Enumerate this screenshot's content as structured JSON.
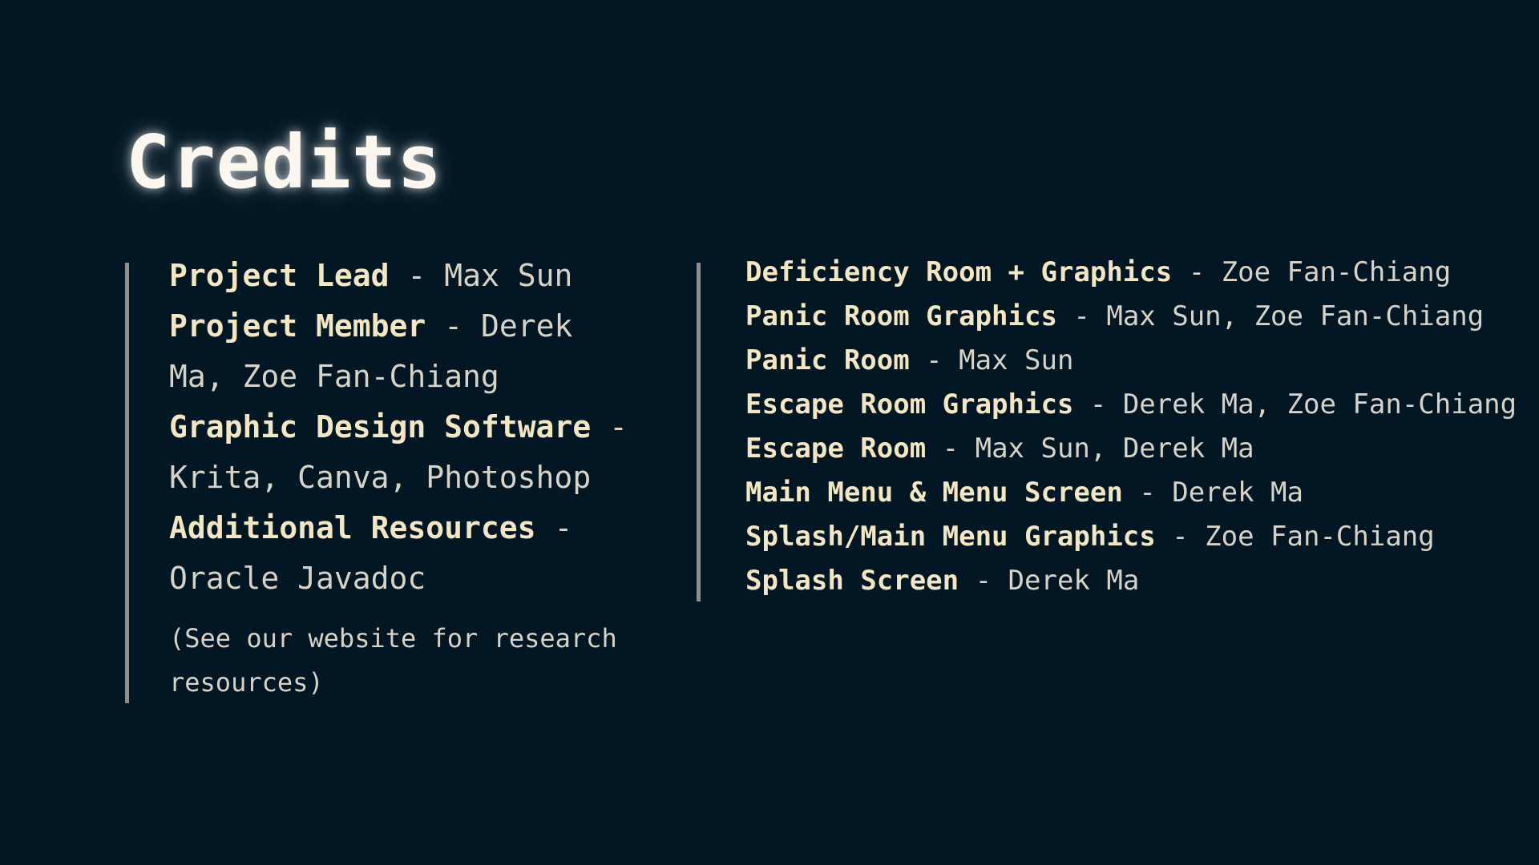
{
  "title": "Credits",
  "separator": " - ",
  "left_entries": [
    {
      "role": "Project Lead",
      "names": "Max Sun"
    },
    {
      "role": "Project Member",
      "names": "Derek Ma, Zoe Fan-Chiang"
    },
    {
      "role": "Graphic Design Software",
      "names": "Krita, Canva, Photoshop"
    },
    {
      "role": "Additional Resources",
      "names": "Oracle Javadoc"
    }
  ],
  "note": "(See our website for research resources)",
  "right_entries": [
    {
      "role": "Deficiency Room + Graphics",
      "names": "Zoe Fan-Chiang"
    },
    {
      "role": "Panic Room Graphics",
      "names": "Max Sun, Zoe Fan-Chiang"
    },
    {
      "role": "Panic Room",
      "names": "Max Sun"
    },
    {
      "role": "Escape Room Graphics",
      "names": "Derek Ma, Zoe Fan-Chiang"
    },
    {
      "role": "Escape Room",
      "names": "Max Sun, Derek Ma"
    },
    {
      "role": "Main Menu & Menu Screen",
      "names": "Derek Ma"
    },
    {
      "role": "Splash/Main Menu Graphics",
      "names": "Zoe Fan-Chiang"
    },
    {
      "role": "Splash Screen",
      "names": "Derek Ma"
    }
  ],
  "colors": {
    "background": "#021623",
    "role_text": "#f2e6c3",
    "name_text": "#d7d3c8",
    "divider": "#8f8f8f"
  }
}
